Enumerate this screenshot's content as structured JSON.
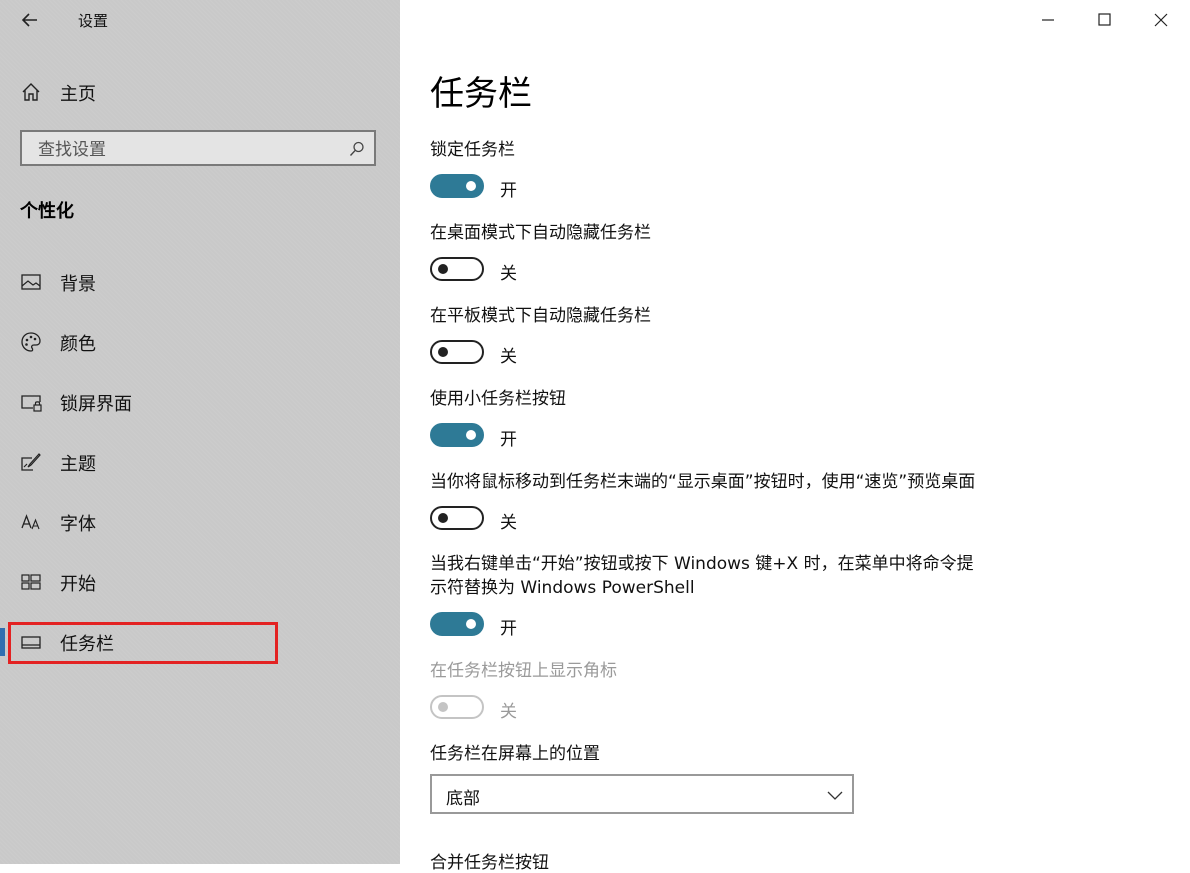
{
  "window": {
    "title": "设置"
  },
  "sidebar": {
    "home_label": "主页",
    "search_placeholder": "查找设置",
    "section": "个性化",
    "items": [
      {
        "label": "背景",
        "icon": "image-icon"
      },
      {
        "label": "颜色",
        "icon": "palette-icon"
      },
      {
        "label": "锁屏界面",
        "icon": "lock-screen-icon"
      },
      {
        "label": "主题",
        "icon": "theme-brush-icon"
      },
      {
        "label": "字体",
        "icon": "font-icon"
      },
      {
        "label": "开始",
        "icon": "start-grid-icon"
      },
      {
        "label": "任务栏",
        "icon": "taskbar-icon",
        "active": true
      }
    ]
  },
  "main": {
    "title": "任务栏",
    "settings": [
      {
        "label": "锁定任务栏",
        "state": "开",
        "on": true
      },
      {
        "label": "在桌面模式下自动隐藏任务栏",
        "state": "关",
        "on": false
      },
      {
        "label": "在平板模式下自动隐藏任务栏",
        "state": "关",
        "on": false
      },
      {
        "label": "使用小任务栏按钮",
        "state": "开",
        "on": true
      },
      {
        "label": "当你将鼠标移动到任务栏末端的“显示桌面”按钮时，使用“速览”预览桌面",
        "state": "关",
        "on": false
      },
      {
        "label_line1": "当我右键单击“开始”按钮或按下 Windows 键+X 时，在菜单中将命令提",
        "label_line2": "示符替换为 Windows PowerShell",
        "state": "开",
        "on": true
      },
      {
        "label": "在任务栏按钮上显示角标",
        "state": "关",
        "on": false,
        "disabled": true
      }
    ],
    "position_label": "任务栏在屏幕上的位置",
    "position_value": "底部",
    "next_label": "合并任务栏按钮"
  },
  "colors": {
    "accent": "#2e7a96",
    "nav_accent": "#2f6fb0",
    "highlight": "#e32222"
  }
}
